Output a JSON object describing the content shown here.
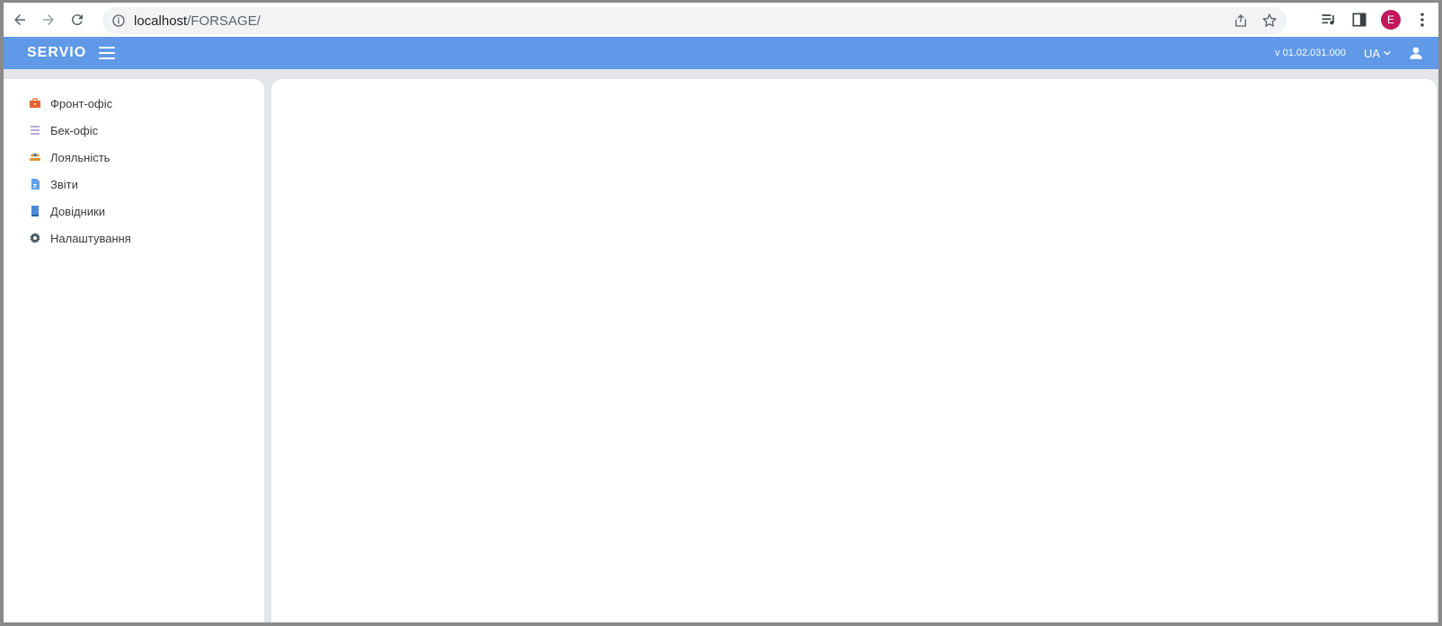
{
  "browser": {
    "url_host": "localhost",
    "url_path": "/FORSAGE/",
    "profile_initial": "E",
    "profile_color": "#c2185b"
  },
  "header": {
    "brand": "SERVIO",
    "version": "v 01.02.031.000",
    "language": "UA",
    "color": "#5f99e8"
  },
  "sidebar": {
    "items": [
      {
        "label": "Фронт-офіс",
        "icon": "briefcase-icon",
        "color": "#e8632c"
      },
      {
        "label": "Бек-офіс",
        "icon": "list-icon",
        "color": "#b8a9d9"
      },
      {
        "label": "Лояльність",
        "icon": "users-icon",
        "color": "#e8902c"
      },
      {
        "label": "Звіти",
        "icon": "report-icon",
        "color": "#5fa0e8"
      },
      {
        "label": "Довідники",
        "icon": "book-icon",
        "color": "#4a8ad8"
      },
      {
        "label": "Налаштування",
        "icon": "gear-icon",
        "color": "#455a64"
      }
    ]
  }
}
